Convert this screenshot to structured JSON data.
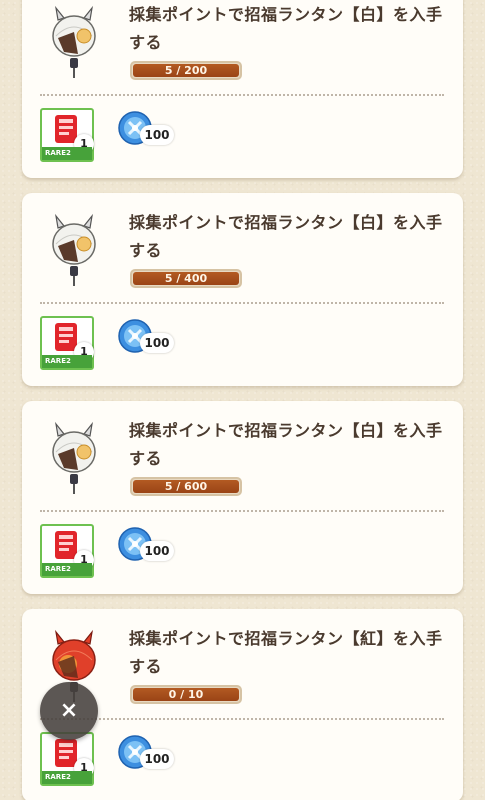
{
  "missions": [
    {
      "title": "採集ポイントで招福ランタン【白】を入手する",
      "progress_text": "5 / 200",
      "progress_fraction": 0.025,
      "lantern_color": "white",
      "rewards": {
        "item_rarity": "RARE2",
        "item_count": "1",
        "currency_icon": "blue-orb-icon",
        "currency_amount": "100"
      }
    },
    {
      "title": "採集ポイントで招福ランタン【白】を入手する",
      "progress_text": "5 / 400",
      "progress_fraction": 0.0125,
      "lantern_color": "white",
      "rewards": {
        "item_rarity": "RARE2",
        "item_count": "1",
        "currency_icon": "blue-orb-icon",
        "currency_amount": "100"
      }
    },
    {
      "title": "採集ポイントで招福ランタン【白】を入手する",
      "progress_text": "5 / 600",
      "progress_fraction": 0.0083,
      "lantern_color": "white",
      "rewards": {
        "item_rarity": "RARE2",
        "item_count": "1",
        "currency_icon": "blue-orb-icon",
        "currency_amount": "100"
      }
    },
    {
      "title": "採集ポイントで招福ランタン【紅】を入手する",
      "progress_text": "0 / 10",
      "progress_fraction": 0.0,
      "lantern_color": "red",
      "rewards": {
        "item_rarity": "RARE2",
        "item_count": "1",
        "currency_icon": "blue-orb-icon",
        "currency_amount": "100"
      }
    }
  ],
  "close_button": {
    "label": "×",
    "icon": "close-icon"
  },
  "colors": {
    "background": "#efe6d2",
    "card": "#fffdf8",
    "progress_fill": "#a84d1a",
    "rare_green": "#47a23a",
    "title_text": "#4a3a2e"
  }
}
